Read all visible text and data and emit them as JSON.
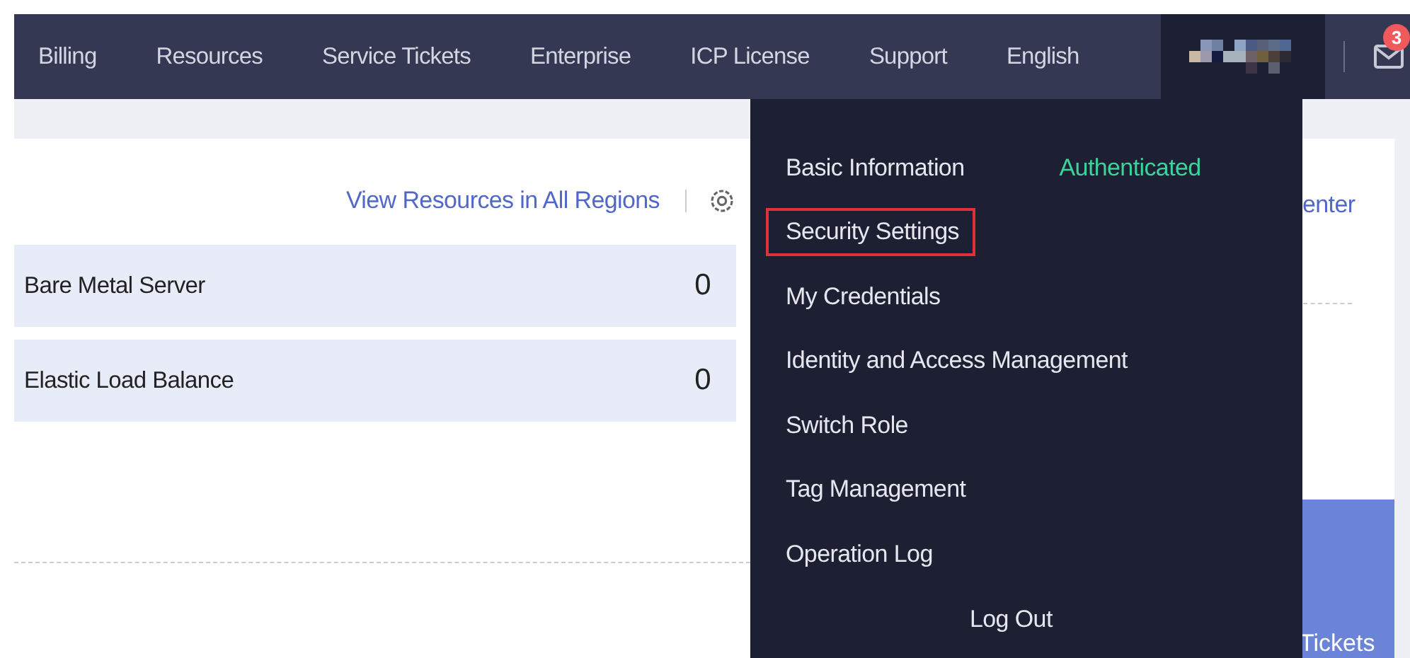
{
  "nav": {
    "items": [
      {
        "label": "Billing"
      },
      {
        "label": "Resources"
      },
      {
        "label": "Service Tickets"
      },
      {
        "label": "Enterprise"
      },
      {
        "label": "ICP License"
      },
      {
        "label": "Support"
      },
      {
        "label": "English"
      }
    ],
    "notifications": "3"
  },
  "resources": {
    "link": "View Resources in All Regions",
    "rows": [
      {
        "name": "Bare Metal Server",
        "count": "0"
      },
      {
        "name": "Elastic Load Balance",
        "count": "0"
      }
    ]
  },
  "right_card": {
    "link": "enter",
    "tile_label": "Tickets"
  },
  "user_menu": {
    "status": "Authenticated",
    "items": [
      {
        "label": "Basic Information",
        "highlighted": false
      },
      {
        "label": "Security Settings",
        "highlighted": true
      },
      {
        "label": "My Credentials",
        "highlighted": false
      },
      {
        "label": "Identity and Access Management",
        "highlighted": false
      },
      {
        "label": "Switch Role",
        "highlighted": false
      },
      {
        "label": "Tag Management",
        "highlighted": false
      },
      {
        "label": "Operation Log",
        "highlighted": false
      }
    ],
    "logout": "Log Out"
  }
}
